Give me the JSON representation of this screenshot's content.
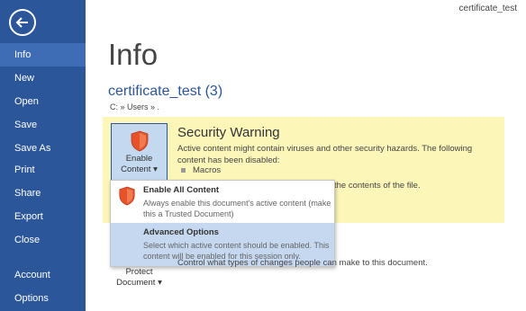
{
  "window": {
    "doc_title": "certificate_test"
  },
  "sidebar": {
    "items": [
      {
        "label": "Info",
        "active": true
      },
      {
        "label": "New"
      },
      {
        "label": "Open"
      },
      {
        "label": "Save"
      },
      {
        "label": "Save As"
      },
      {
        "label": "Print"
      },
      {
        "label": "Share"
      },
      {
        "label": "Export"
      },
      {
        "label": "Close"
      },
      {
        "label": "Account"
      },
      {
        "label": "Options"
      }
    ]
  },
  "main": {
    "title": "Info",
    "doc_name": "certificate_test (3)",
    "doc_path": "C: » Users » ."
  },
  "warning": {
    "title": "Security Warning",
    "text": "Active content might contain viruses and other security hazards. The following content has been disabled:",
    "macros": "Macros",
    "text2": "the contents of the file.",
    "enable_button_line1": "Enable",
    "enable_button_line2": "Content ▾"
  },
  "dropdown": {
    "items": [
      {
        "title": "Enable All Content",
        "desc": "Always enable this document's active content (make this a Trusted Document)"
      },
      {
        "title": "Advanced Options",
        "desc": "Select which active content should be enabled. This content will be enabled for this session only."
      }
    ]
  },
  "protect": {
    "button_line1": "Protect",
    "button_line2": "Document ▾",
    "text": "Control what types of changes people can make to this document."
  },
  "colors": {
    "sidebar": "#2b579a",
    "warning_bg": "#fcf6b8",
    "shield": "#e8522b",
    "hover": "#c5d8f0"
  }
}
